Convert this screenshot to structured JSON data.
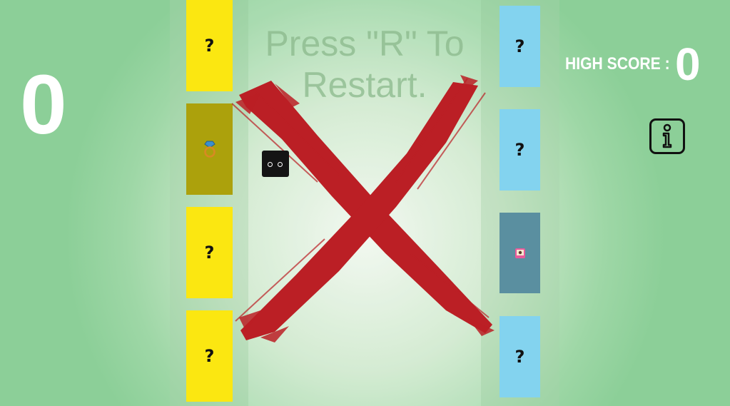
{
  "score": "0",
  "high_score": {
    "label": "HIGH SCORE :",
    "value": "0"
  },
  "restart_message": "Press \"R\" To Restart.",
  "left_cards": [
    {
      "label": "?",
      "revealed": false
    },
    {
      "label": "",
      "revealed": true,
      "icon": "ring-icon"
    },
    {
      "label": "?",
      "revealed": false
    },
    {
      "label": "?",
      "revealed": false
    }
  ],
  "right_cards": [
    {
      "label": "?",
      "revealed": false
    },
    {
      "label": "?",
      "revealed": false
    },
    {
      "label": "",
      "revealed": true,
      "icon": "photo-card-icon"
    },
    {
      "label": "?",
      "revealed": false
    }
  ],
  "colors": {
    "yellow_card": "#fbe711",
    "blue_card": "#83d3ef",
    "x_mark": "#bb1f25",
    "player": "#141414"
  },
  "info_icon": "info-icon"
}
